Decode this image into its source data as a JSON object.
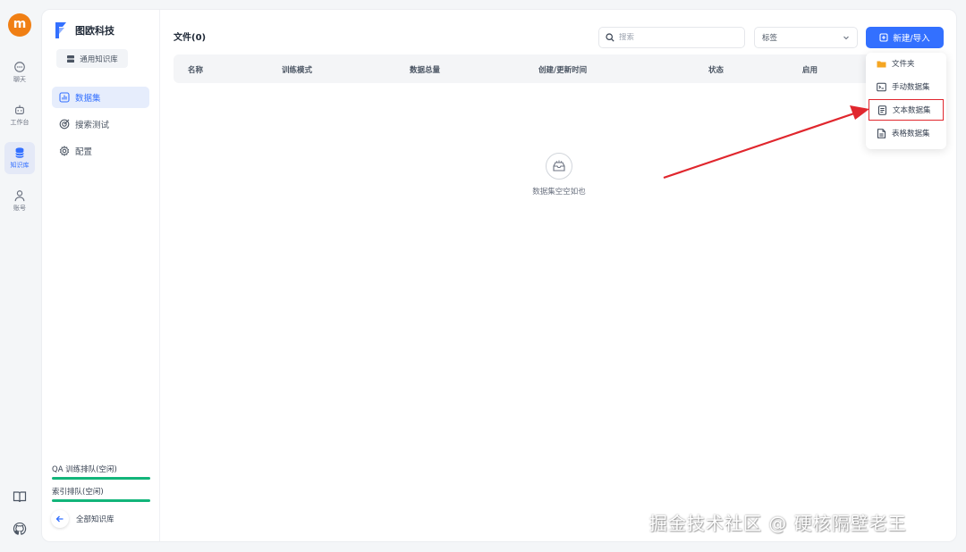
{
  "user": {
    "avatar_letter": "m"
  },
  "rail": {
    "items": [
      {
        "label": "聊天",
        "icon": "chat-icon",
        "active": false
      },
      {
        "label": "工作台",
        "icon": "robot-icon",
        "active": false
      },
      {
        "label": "知识库",
        "icon": "database-icon",
        "active": true
      },
      {
        "label": "账号",
        "icon": "person-icon",
        "active": false
      }
    ],
    "bottom_icons": [
      "book-icon",
      "github-icon"
    ]
  },
  "sidebar": {
    "brand_name": "图欧科技",
    "kb_type_label": "通用知识库",
    "nav": [
      {
        "label": "数据集",
        "icon": "bar-chart-icon",
        "active": true
      },
      {
        "label": "搜索测试",
        "icon": "target-icon",
        "active": false
      },
      {
        "label": "配置",
        "icon": "gear-icon",
        "active": false
      }
    ],
    "queues": [
      {
        "label": "QA 训练排队(空闲)"
      },
      {
        "label": "索引排队(空闲)"
      }
    ],
    "back_label": "全部知识库"
  },
  "main": {
    "title": "文件(0)",
    "search_placeholder": "搜索",
    "tag_select_value": "标签",
    "new_button_label": "新建/导入",
    "columns": [
      "名称",
      "训练模式",
      "数据总量",
      "创建/更新时间",
      "状态",
      "启用"
    ],
    "empty_text": "数据集空空如也"
  },
  "dropdown": {
    "items": [
      {
        "label": "文件夹",
        "icon": "folder-icon",
        "highlighted": false
      },
      {
        "label": "手动数据集",
        "icon": "terminal-icon",
        "highlighted": false
      },
      {
        "label": "文本数据集",
        "icon": "document-icon",
        "highlighted": true
      },
      {
        "label": "表格数据集",
        "icon": "table-file-icon",
        "highlighted": false
      }
    ]
  },
  "colors": {
    "accent": "#3370ff",
    "avatar": "#f07f14",
    "queue_bar": "#12b57a",
    "annotation_red": "#e0262d",
    "folder": "#f5a623"
  },
  "watermark": "掘金技术社区 @ 硬核隔壁老王"
}
